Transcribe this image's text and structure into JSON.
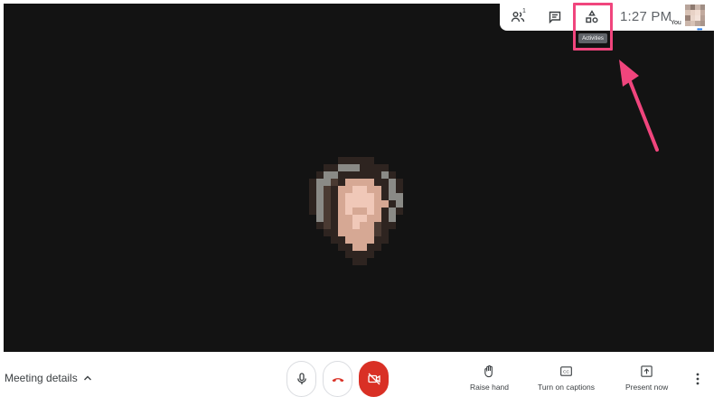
{
  "topbar": {
    "people_count": "1",
    "clock": "1:27 PM",
    "self_label": "You",
    "self_dots": "•••",
    "activities_tooltip": "Activities",
    "icons": [
      "people-icon",
      "chat-icon",
      "activities-icon"
    ]
  },
  "bottombar": {
    "meeting_details": "Meeting details",
    "raise_hand": "Raise hand",
    "captions": "Turn on captions",
    "present": "Present now"
  },
  "colors": {
    "highlight": "#f0457d",
    "end_call": "#d93025",
    "stage_bg": "#131313"
  }
}
